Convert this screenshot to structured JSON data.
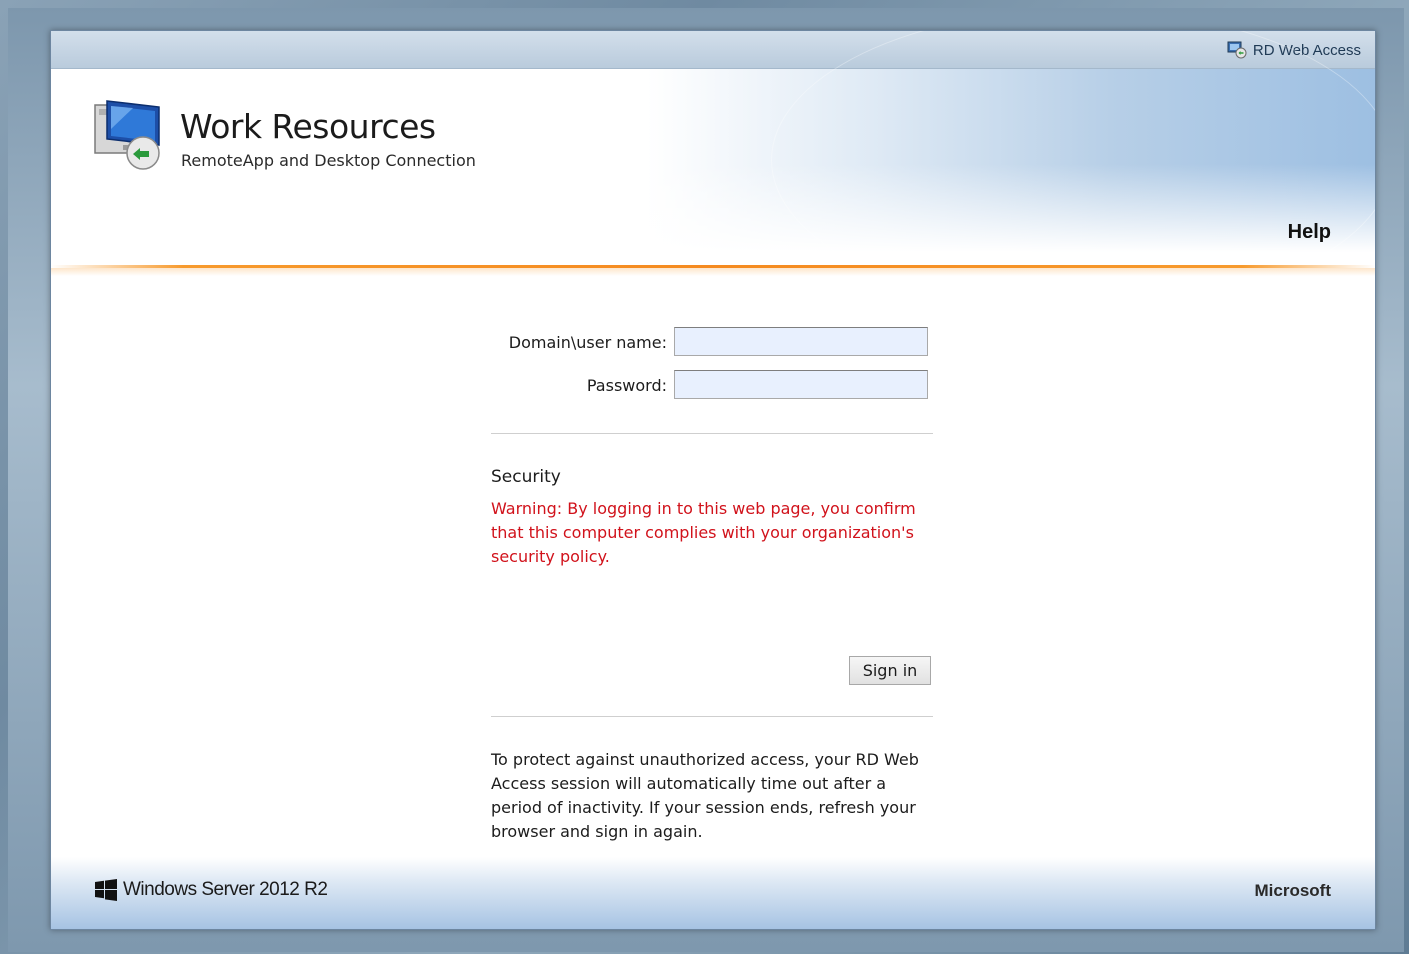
{
  "topbar": {
    "product_label": "RD Web Access",
    "icon": "rd-web-access-icon"
  },
  "header": {
    "title": "Work Resources",
    "subtitle": "RemoteApp and Desktop Connection",
    "help_label": "Help",
    "logo_icon": "remote-desktop-icon"
  },
  "login_form": {
    "username_label": "Domain\\user name:",
    "username_value": "",
    "password_label": "Password:",
    "password_value": "",
    "security_title": "Security",
    "security_warning": "Warning: By logging in to this web page, you confirm that this computer complies with your organization's security policy.",
    "signin_label": "Sign in",
    "timeout_notice": "To protect against unauthorized access, your RD Web Access session will automatically time out after a period of inactivity. If your session ends, refresh your browser and sign in again."
  },
  "footer": {
    "os_label": "Windows Server 2012 R2",
    "vendor_label": "Microsoft",
    "os_icon": "windows-logo-icon"
  },
  "colors": {
    "accent_orange": "#f58a1f",
    "warning_red": "#d1121b",
    "input_bg": "#e8f0fe"
  }
}
